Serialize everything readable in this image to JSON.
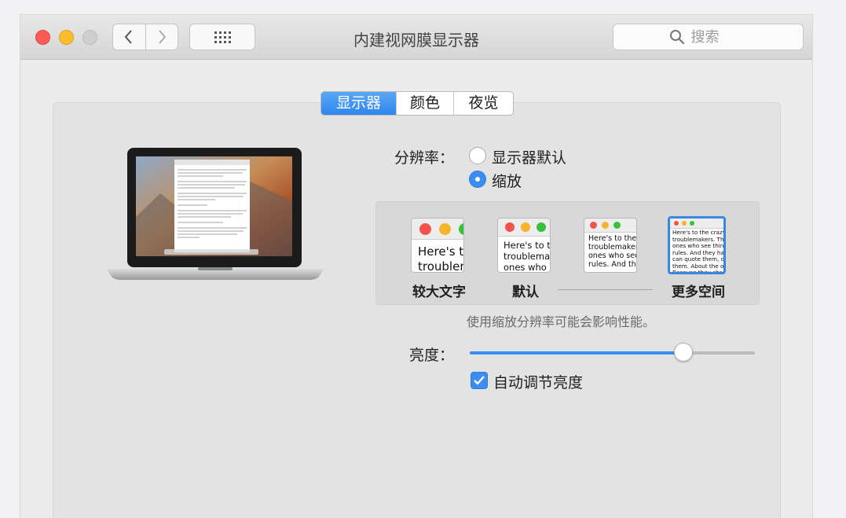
{
  "window": {
    "title": "内建视网膜显示器"
  },
  "toolbar": {
    "back_icon": "chevron-left-icon",
    "forward_icon": "chevron-right-icon",
    "grid_icon": "grid-icon"
  },
  "search": {
    "placeholder": "搜索",
    "icon": "search-icon"
  },
  "tabs": [
    {
      "label": "显示器",
      "active": true
    },
    {
      "label": "颜色",
      "active": false
    },
    {
      "label": "夜览",
      "active": false
    }
  ],
  "resolution": {
    "label": "分辨率：",
    "options": [
      {
        "label": "显示器默认",
        "selected": false
      },
      {
        "label": "缩放",
        "selected": true
      }
    ]
  },
  "scale": {
    "options": [
      {
        "label": "较大文字",
        "preview": "Here's to\ntroublem",
        "selected": false
      },
      {
        "label": "默认",
        "preview": "Here's to th\ntroublemak\nones who c",
        "selected": false
      },
      {
        "label": "",
        "preview": "Here's to the cr\ntroublemakers.\nones who see t\nrules. And they",
        "selected": false
      },
      {
        "label": "更多空间",
        "preview": "Here's to the crazy ones\ntroublemakers. The rou\nones who see things dif\nrules. And they have no\ncan quote them, disagre\nthem. About the only th\nBecause they change t",
        "selected": true
      }
    ],
    "warning": "使用缩放分辨率可能会影响性能。"
  },
  "brightness": {
    "label": "亮度：",
    "level": 0.75
  },
  "auto_brightness": {
    "label": "自动调节亮度",
    "checked": true
  },
  "colors": {
    "accent": "#3b8df0",
    "close": "#fc5b56",
    "minimize": "#fdbc2e",
    "zoom": "#cfcfcf"
  }
}
